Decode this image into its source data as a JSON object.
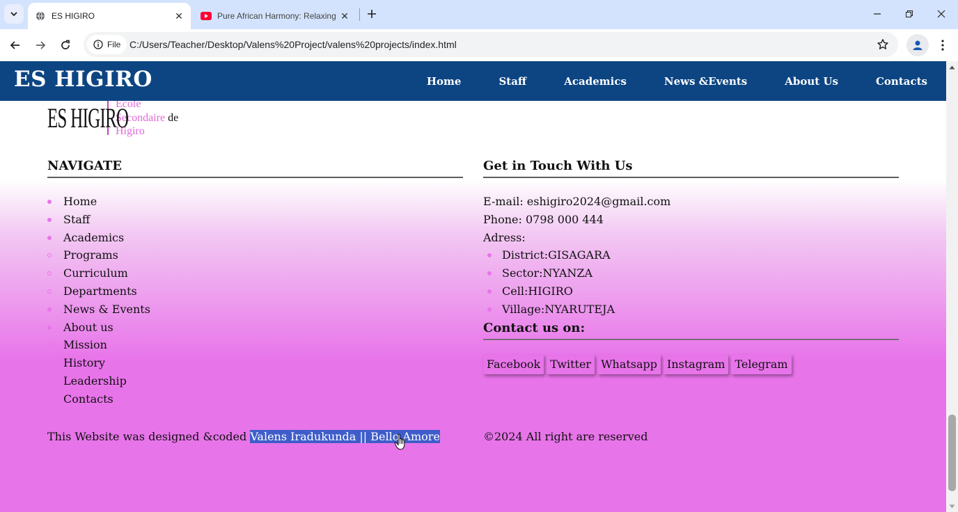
{
  "browser": {
    "tabs": [
      {
        "title": "ES HIGIRO",
        "favicon": "globe-icon",
        "active": true
      },
      {
        "title": "Pure African Harmony: Relaxing",
        "favicon": "youtube-icon",
        "active": false
      }
    ],
    "site_chip": "File",
    "url": "C:/Users/Teacher/Desktop/Valens%20Project/valens%20projects/index.html"
  },
  "site": {
    "brand": "ES HIGIRO",
    "nav": [
      "Home",
      "Staff",
      "Academics",
      "News &Events",
      "About Us",
      "Contacts"
    ]
  },
  "logo": {
    "mark": "ES HIGIRO",
    "line1": "Ecole",
    "line2": "Secondaire",
    "line2_suffix": "de",
    "line3": "Higiro"
  },
  "footer": {
    "navigate_heading": "NAVIGATE",
    "navigate_items": [
      {
        "label": "Home",
        "bullet": "filled"
      },
      {
        "label": "Staff",
        "bullet": "filled"
      },
      {
        "label": "Academics",
        "bullet": "filled"
      },
      {
        "label": "Programs",
        "bullet": "ring"
      },
      {
        "label": "Curriculum",
        "bullet": "ring"
      },
      {
        "label": "Departments",
        "bullet": "ring"
      },
      {
        "label": "News & Events",
        "bullet": "filled"
      },
      {
        "label": "About us",
        "bullet": "filled"
      },
      {
        "label": "Mission",
        "bullet": "ring"
      },
      {
        "label": "History",
        "bullet": "none"
      },
      {
        "label": "Leadership",
        "bullet": "none"
      },
      {
        "label": "Contacts",
        "bullet": "none"
      }
    ],
    "contact_heading": "Get in Touch With Us",
    "email_line": "E-mail: eshigiro2024@gmail.com",
    "phone_line": "Phone: 0798 000 444",
    "address_label": "Adress:",
    "address_items": [
      "District:GISAGARA",
      "Sector:NYANZA",
      "Cell:HIGIRO",
      "Village:NYARUTEJA"
    ],
    "contact_on_heading": "Contact us on:",
    "social": [
      "Facebook",
      "Twitter",
      "Whatsapp",
      "Instagram",
      "Telegram"
    ],
    "credits_prefix": "This Website was designed &coded ",
    "credits_names": "Valens Iradukunda || Bello Amore",
    "copyright": "©2024 All right are reserved"
  },
  "colors": {
    "header_bg": "#0d4583",
    "accent_pink": "#e874ea",
    "selection": "#3f5dca"
  }
}
